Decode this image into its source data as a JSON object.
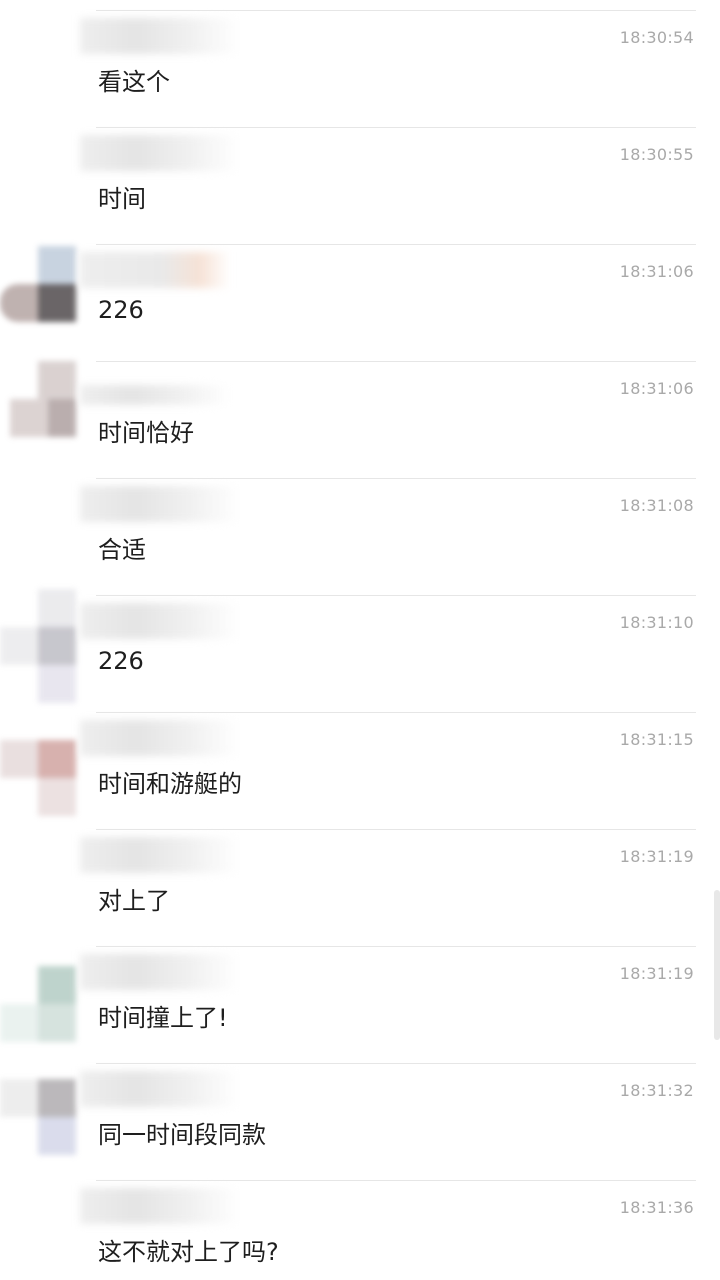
{
  "messages": [
    {
      "time": "18:30:54",
      "text": "看这个"
    },
    {
      "time": "18:30:55",
      "text": "时间"
    },
    {
      "time": "18:31:06",
      "text": "226"
    },
    {
      "time": "18:31:06",
      "text": "时间恰好"
    },
    {
      "time": "18:31:08",
      "text": "合适"
    },
    {
      "time": "18:31:10",
      "text": "226"
    },
    {
      "time": "18:31:15",
      "text": "时间和游艇的"
    },
    {
      "time": "18:31:19",
      "text": "对上了"
    },
    {
      "time": "18:31:19",
      "text": "时间撞上了!"
    },
    {
      "time": "18:31:32",
      "text": "同一时间段同款"
    },
    {
      "time": "18:31:36",
      "text": "这不就对上了吗?"
    }
  ],
  "colors": {
    "background": "#ffffff",
    "divider": "#e6e6e6",
    "timestamp": "#a9a9a9",
    "message_text": "#1e1e1e"
  }
}
